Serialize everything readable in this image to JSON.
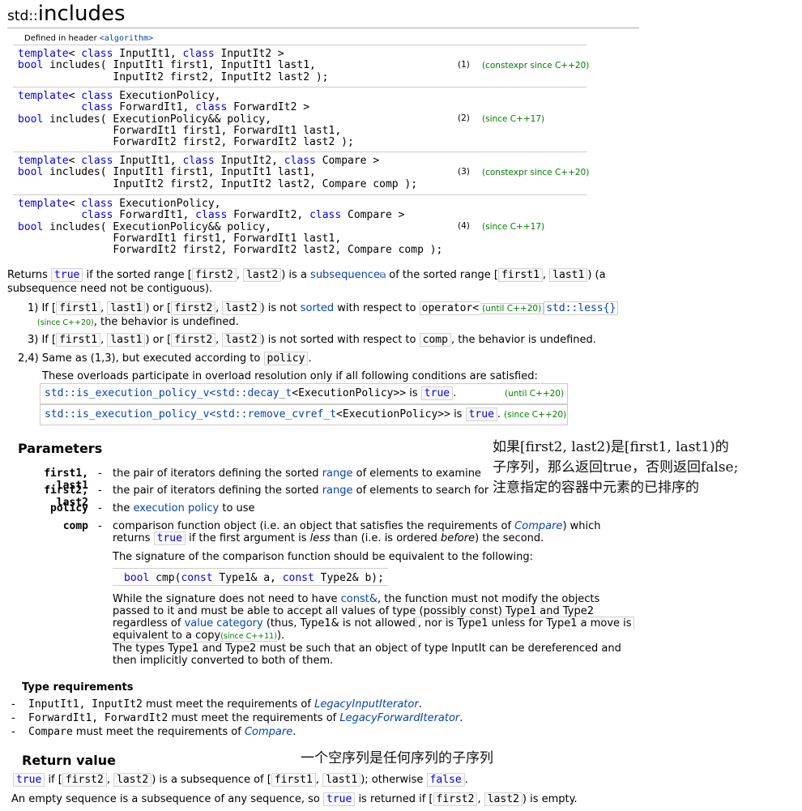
{
  "title": {
    "ns": "std::",
    "name": "includes"
  },
  "header_text": {
    "prefix": "Defined in header ",
    "header": "<algorithm>"
  },
  "overloads": [
    {
      "lines": [
        "template< class InputIt1, class InputIt2 >",
        "bool includes( InputIt1 first1, InputIt1 last1,",
        "               InputIt2 first2, InputIt2 last2 );"
      ],
      "num": "(1)",
      "ver": "(constexpr since C++20)"
    },
    {
      "lines": [
        "template< class ExecutionPolicy,",
        "          class ForwardIt1, class ForwardIt2 >",
        "bool includes( ExecutionPolicy&& policy,",
        "               ForwardIt1 first1, ForwardIt1 last1,",
        "               ForwardIt2 first2, ForwardIt2 last2 );"
      ],
      "num": "(2)",
      "ver": "(since C++17)"
    },
    {
      "lines": [
        "template< class InputIt1, class InputIt2, class Compare >",
        "bool includes( InputIt1 first1, InputIt1 last1,",
        "               InputIt2 first2, InputIt2 last2, Compare comp );"
      ],
      "num": "(3)",
      "ver": "(constexpr since C++20)"
    },
    {
      "lines": [
        "template< class ExecutionPolicy,",
        "          class ForwardIt1, class ForwardIt2, class Compare >",
        "bool includes( ExecutionPolicy&& policy,",
        "               ForwardIt1 first1, ForwardIt1 last1,",
        "               ForwardIt2 first2, ForwardIt2 last2, Compare comp );"
      ],
      "num": "(4)",
      "ver": "(since C++17)"
    }
  ],
  "desc": {
    "p1a": "Returns ",
    "true": "true",
    "p1b": " if the sorted range [",
    "first2": "first2",
    "comma": ", ",
    "last2": "last2",
    "p1c": ") is a ",
    "subsequence": "subsequence",
    "p1d": " of the sorted range [",
    "first1": "first1",
    "last1": "last1",
    "p1e": ") (a",
    "p1f": "subsequence need not be contiguous).",
    "i1a": "1) If [",
    "i1b": ") or [",
    "i1c": ") is not ",
    "sorted": "sorted",
    "i1d": " with respect to ",
    "operator_less": "operator<",
    "until20": "(until C++20)",
    "std_less": "std::less{}",
    "since20": "(since C++20)",
    "i1e": ", the behavior is undefined.",
    "i3a": "3) If [",
    "i3c": ") is not sorted with respect to ",
    "comp": "comp",
    "i3e": ", the behavior is undefined.",
    "i24a": "2,4) Same as (1,3), but executed according to ",
    "policy": "policy",
    "dot": ".",
    "cond_intro": "These overloads participate in overload resolution only if all following conditions are satisfied:",
    "cond1a": "std::is_execution_policy_v",
    "cond1b": "<std::decay_t",
    "cond1c": "<ExecutionPolicy>>",
    "is": " is ",
    "cond1ver": "(until C++20)",
    "cond2b": "<std::remove_cvref_t",
    "cond2ver": "(since C++20)"
  },
  "cn_note1": [
    "如果[first2, last2)是[first1, last1)的",
    "子序列，那么返回true，否则返回false;",
    "注意指定的容器中元素的已排序的"
  ],
  "params": {
    "heading": "Parameters",
    "rows": [
      {
        "name": "first1, last1",
        "dash": "-",
        "a": "the pair of iterators defining the sorted ",
        "link": "range",
        "b": " of elements to examine"
      },
      {
        "name": "first2, last2",
        "dash": "-",
        "a": "the pair of iterators defining the sorted ",
        "link": "range",
        "b": " of elements to search for"
      },
      {
        "name": "policy",
        "dash": "-",
        "a": "the ",
        "link": "execution policy",
        "b": " to use"
      },
      {
        "name": "comp",
        "dash": "-",
        "a": "comparison function object (i.e. an object that satisfies the requirements of ",
        "link": "Compare",
        "b": ") which"
      }
    ],
    "comp_l2a": "returns ",
    "comp_l2b": " if the first argument is ",
    "less": "less",
    "comp_l2c": " than (i.e. is ordered ",
    "before": "before",
    "comp_l2d": ") the second.",
    "sig_intro": "The signature of the comparison function should be equivalent to the following:",
    "sig_code_kw1": "bool",
    "sig_code_a": " cmp(",
    "sig_code_kw2": "const",
    "sig_code_b": " Type1& a, ",
    "sig_code_kw3": "const",
    "sig_code_c": " Type2& b);",
    "w1a": "While the signature does not need to have ",
    "constamp": "const&",
    "w1b": ", the function must not modify the objects",
    "w2": "passed to it and must be able to accept all values of type (possibly const) Type1 and Type2",
    "w3a": "regardless of ",
    "valcat": "value category",
    "w3b": " (thus, Type1& is not allowed",
    "w3c": ", nor is Type1 unless for Type1 a move is",
    "w4a": "equivalent to a copy",
    "since11": "(since C++11)",
    "w4b": ").",
    "w5": "The types Type1 and Type2 must be such that an object of type InputIt can be dereferenced and",
    "w6": "then implicitly converted to both of them."
  },
  "typereq": {
    "heading": "Type requirements",
    "rows": [
      {
        "dash": "-",
        "names": "InputIt1, InputIt2",
        "mid": " must meet the requirements of ",
        "link": "LegacyInputIterator",
        "end": "."
      },
      {
        "dash": "-",
        "names": "ForwardIt1, ForwardIt2",
        "mid": " must meet the requirements of ",
        "link": "LegacyForwardIterator",
        "end": "."
      },
      {
        "dash": "-",
        "names": "Compare",
        "mid": " must meet the requirements of ",
        "link": "Compare",
        "end": "."
      }
    ]
  },
  "retval": {
    "heading": "Return value",
    "cn_note": "一个空序列是任何序列的子序列",
    "l1a": " if [",
    "l1b": ") is a subsequence of [",
    "l1c": "); otherwise ",
    "false": "false",
    "l1d": ".",
    "l2a": "An empty sequence is a subsequence of any sequence, so ",
    "l2b": " is returned if [",
    "l2c": ") is empty."
  }
}
